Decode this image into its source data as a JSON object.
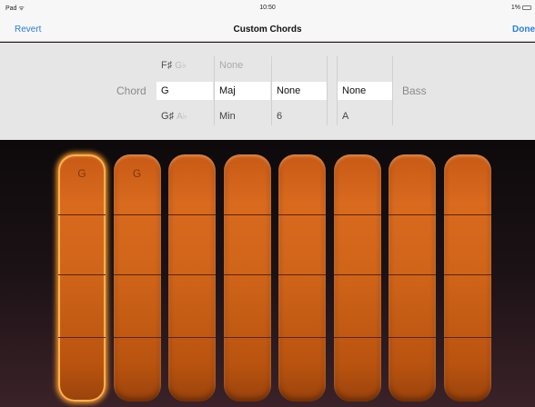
{
  "status": {
    "left": "Pad ᯤ",
    "time": "10:50",
    "battery": "1%"
  },
  "nav": {
    "revert": "Revert",
    "title": "Custom Chords",
    "done": "Done"
  },
  "picker": {
    "chord_label": "Chord",
    "bass_label": "Bass",
    "root": {
      "top": "F♯",
      "top_sub": "G♭",
      "selected": "G",
      "bottom": "G♯",
      "bottom_sub": "A♭"
    },
    "quality": {
      "top": "None",
      "selected": "Maj",
      "bottom": "Min"
    },
    "extension": {
      "top": "",
      "selected": "None",
      "bottom": "6"
    },
    "bass": {
      "top": "",
      "selected": "None",
      "bottom": "A"
    }
  },
  "strips": [
    {
      "label": "G",
      "active": true
    },
    {
      "label": "G",
      "active": false
    },
    {
      "label": "",
      "active": false
    },
    {
      "label": "",
      "active": false
    },
    {
      "label": "",
      "active": false
    },
    {
      "label": "",
      "active": false
    },
    {
      "label": "",
      "active": false
    },
    {
      "label": "",
      "active": false
    }
  ],
  "colors": {
    "accent": "#2a7fd8",
    "strip_active_glow": "#ff9a2a",
    "strip": "#d06418"
  }
}
